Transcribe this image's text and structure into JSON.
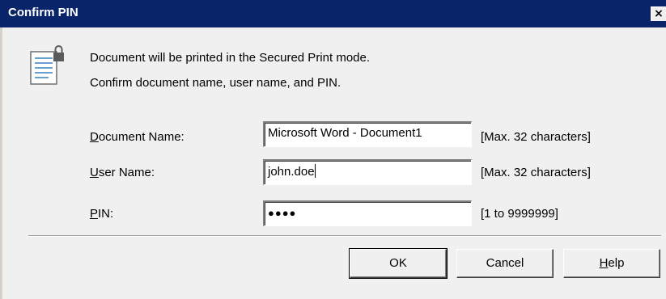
{
  "window": {
    "title": "Confirm PIN",
    "close_glyph": "×"
  },
  "message": {
    "icon": "document-lock-icon",
    "line1": "Document will be printed in the Secured Print mode.",
    "line2": "Confirm document name, user name, and PIN."
  },
  "fields": {
    "document_name": {
      "label_hotkey": "D",
      "label_rest": "ocument Name:",
      "value": "Microsoft Word - Document1",
      "hint": "[Max. 32 characters]"
    },
    "user_name": {
      "label_hotkey": "U",
      "label_rest": "ser Name:",
      "value": "john.doe",
      "hint": "[Max. 32 characters]"
    },
    "pin": {
      "label_hotkey": "P",
      "label_rest": "IN:",
      "value": "●●●●",
      "hint": "[1 to 9999999]"
    }
  },
  "buttons": {
    "ok": "OK",
    "cancel": "Cancel",
    "help_hotkey": "H",
    "help_rest": "elp"
  }
}
